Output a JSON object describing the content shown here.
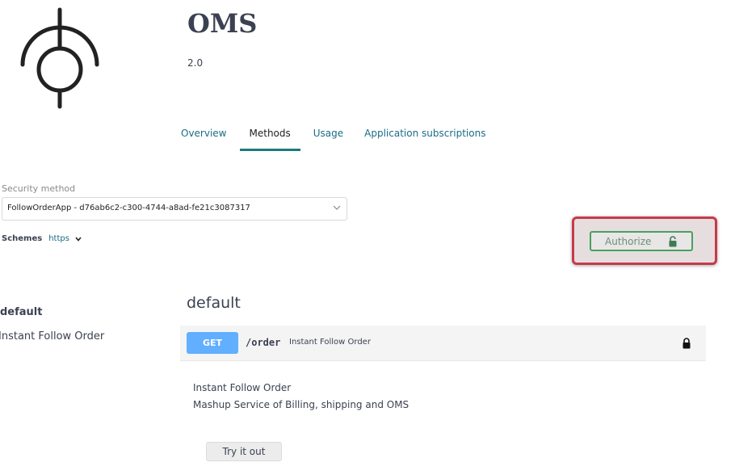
{
  "api": {
    "title": "OMS",
    "version": "2.0"
  },
  "tabs": [
    {
      "label": "Overview"
    },
    {
      "label": "Methods",
      "active": true
    },
    {
      "label": "Usage"
    },
    {
      "label": "Application subscriptions"
    }
  ],
  "security": {
    "label": "Security method",
    "selected": "FollowOrderApp - d76ab6c2-c300-4744-a8ad-fe21c3087317"
  },
  "schemes": {
    "label": "Schemes",
    "value": "https"
  },
  "authorize": {
    "label": "Authorize",
    "highlight_color": "#c73a4a",
    "accent_color": "#49a05f"
  },
  "sidebar": {
    "section": "default",
    "items": [
      {
        "label": "Instant Follow Order"
      }
    ]
  },
  "operations": {
    "group_title": "default",
    "items": [
      {
        "method": "GET",
        "method_color": "#61affe",
        "path": "/order",
        "summary": "Instant Follow Order",
        "description_title": "Instant Follow Order",
        "description": "Mashup Service of Billing, shipping and OMS",
        "try_label": "Try it out"
      }
    ]
  },
  "icons": {
    "logo": "pin-logo-icon",
    "lock_open": "unlock-icon",
    "lock_closed": "lock-icon",
    "chevron": "chevron-down-icon"
  }
}
